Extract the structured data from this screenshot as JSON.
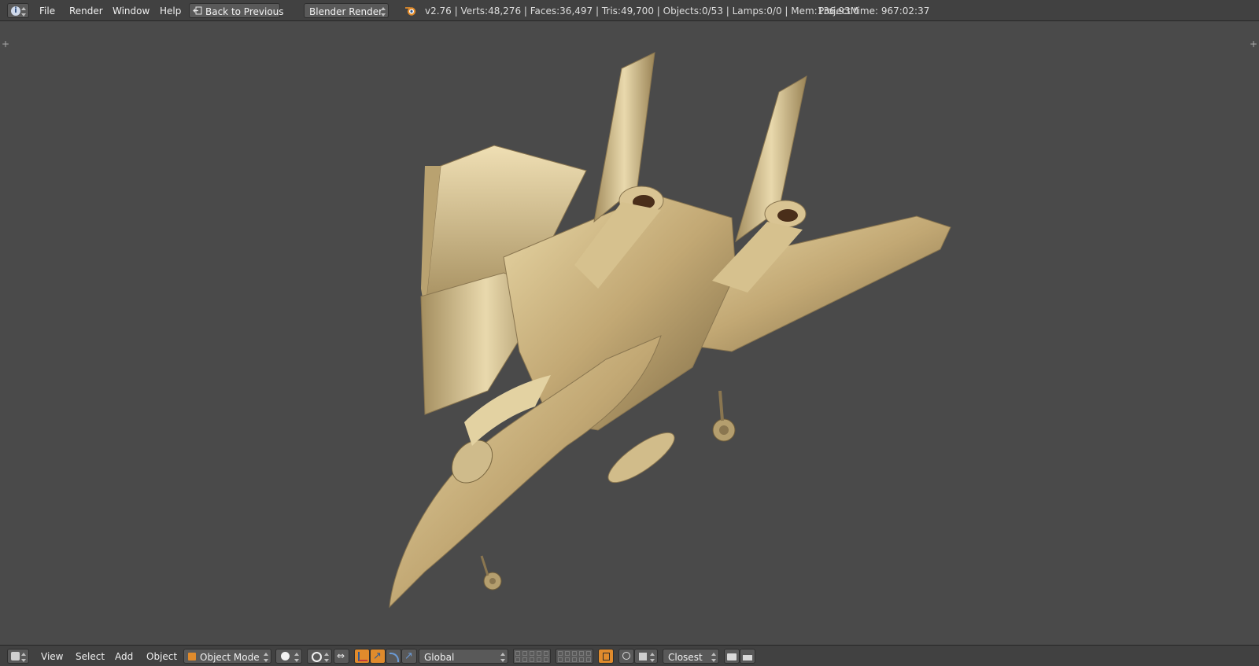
{
  "header": {
    "menus": [
      "File",
      "Render",
      "Window",
      "Help"
    ],
    "back_button": "Back to Previous",
    "render_engine": "Blender Render",
    "stats": "v2.76 | Verts:48,276 | Faces:36,497 | Tris:49,700 | Objects:0/53 | Lamps:0/0 | Mem:136.93M",
    "project_time": "Project time: 967:02:37"
  },
  "footer": {
    "menus": [
      "View",
      "Select",
      "Add",
      "Object"
    ],
    "mode": "Object Mode",
    "orientation": "Global",
    "snap_target": "Closest"
  },
  "colors": {
    "accent_orange": "#e08b2c",
    "model_gold": "#c8b27e"
  }
}
